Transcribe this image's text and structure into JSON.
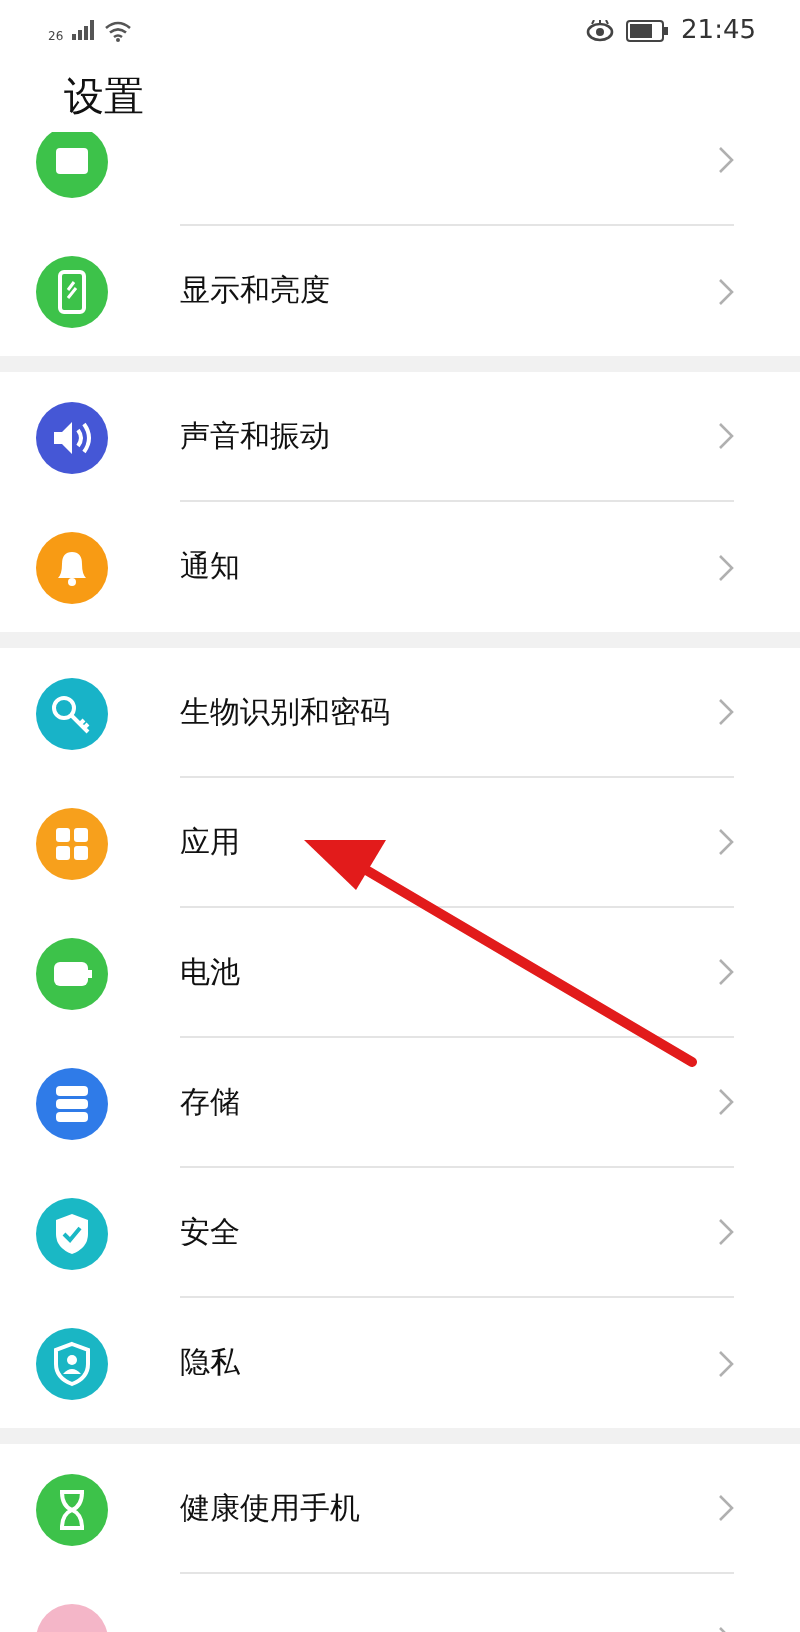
{
  "status_bar": {
    "network": "26",
    "time": "21:45"
  },
  "title": "设置",
  "groups": [
    [
      {
        "color": "#3dc24a"
      },
      {
        "label": "显示和亮度",
        "color": "#3dc24a"
      }
    ],
    [
      {
        "label": "声音和振动",
        "color": "#4557d6"
      },
      {
        "label": "通知",
        "color": "#f89b14"
      }
    ],
    [
      {
        "label": "生物识别和密码",
        "color": "#18b3c8"
      },
      {
        "label": "应用",
        "color": "#f7a01c"
      },
      {
        "label": "电池",
        "color": "#3dc24a"
      },
      {
        "label": "存储",
        "color": "#2f7be8"
      },
      {
        "label": "安全",
        "color": "#1ab8c5"
      },
      {
        "label": "隐私",
        "color": "#1ab6c4"
      }
    ],
    [
      {
        "label": "健康使用手机",
        "color": "#3dc24a"
      },
      {
        "color": "#f4b6c8"
      }
    ]
  ]
}
